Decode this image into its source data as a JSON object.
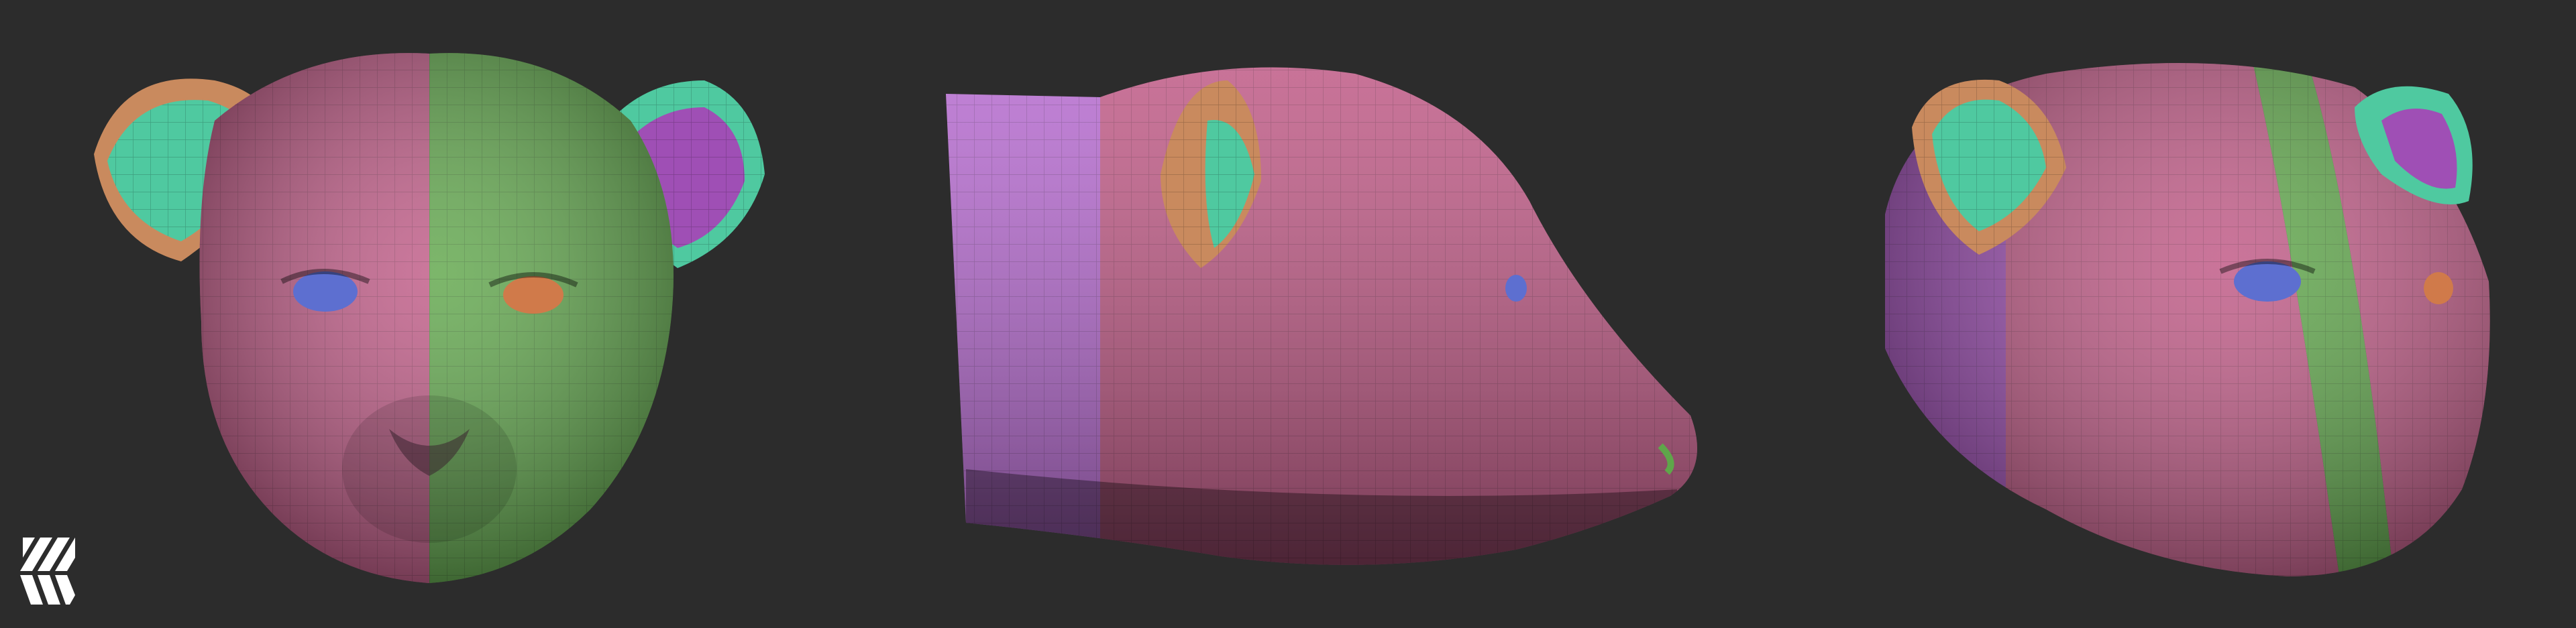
{
  "viewport": {
    "background": "#2c2c2c",
    "views": [
      {
        "name": "front",
        "label": ""
      },
      {
        "name": "side",
        "label": ""
      },
      {
        "name": "three-quarter",
        "label": ""
      }
    ]
  },
  "polygroup_colors": {
    "pink": "#c05a86",
    "pink_dark": "#8e3d63",
    "green": "#5fa64a",
    "green_dark": "#3d7a32",
    "teal": "#4fc9a0",
    "orange": "#c98a5e",
    "purple": "#9f4fb5",
    "violet": "#b66ad0",
    "eye_blue": "#5d6fd0",
    "eye_orange": "#d07a4a"
  },
  "logo": {
    "icon": "studio-logo-icon",
    "color": "#ffffff"
  }
}
